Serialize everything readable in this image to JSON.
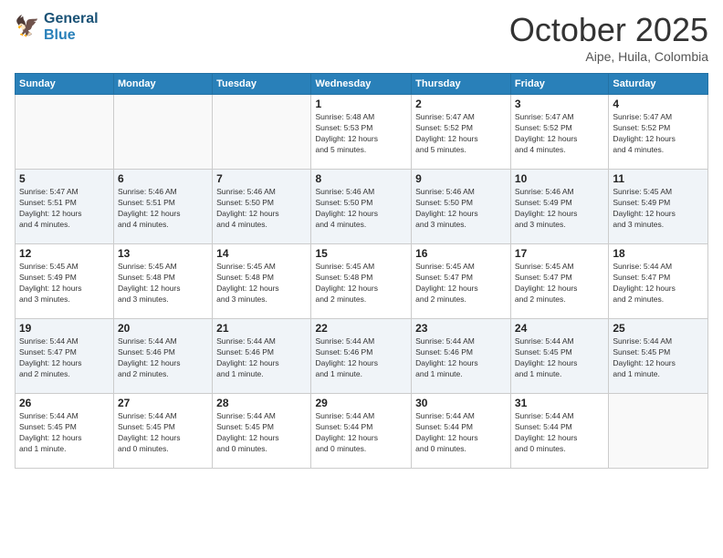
{
  "logo": {
    "line1": "General",
    "line2": "Blue"
  },
  "header": {
    "month": "October 2025",
    "location": "Aipe, Huila, Colombia"
  },
  "weekdays": [
    "Sunday",
    "Monday",
    "Tuesday",
    "Wednesday",
    "Thursday",
    "Friday",
    "Saturday"
  ],
  "weeks": [
    [
      {
        "day": "",
        "info": ""
      },
      {
        "day": "",
        "info": ""
      },
      {
        "day": "",
        "info": ""
      },
      {
        "day": "1",
        "info": "Sunrise: 5:48 AM\nSunset: 5:53 PM\nDaylight: 12 hours\nand 5 minutes."
      },
      {
        "day": "2",
        "info": "Sunrise: 5:47 AM\nSunset: 5:52 PM\nDaylight: 12 hours\nand 5 minutes."
      },
      {
        "day": "3",
        "info": "Sunrise: 5:47 AM\nSunset: 5:52 PM\nDaylight: 12 hours\nand 4 minutes."
      },
      {
        "day": "4",
        "info": "Sunrise: 5:47 AM\nSunset: 5:52 PM\nDaylight: 12 hours\nand 4 minutes."
      }
    ],
    [
      {
        "day": "5",
        "info": "Sunrise: 5:47 AM\nSunset: 5:51 PM\nDaylight: 12 hours\nand 4 minutes."
      },
      {
        "day": "6",
        "info": "Sunrise: 5:46 AM\nSunset: 5:51 PM\nDaylight: 12 hours\nand 4 minutes."
      },
      {
        "day": "7",
        "info": "Sunrise: 5:46 AM\nSunset: 5:50 PM\nDaylight: 12 hours\nand 4 minutes."
      },
      {
        "day": "8",
        "info": "Sunrise: 5:46 AM\nSunset: 5:50 PM\nDaylight: 12 hours\nand 4 minutes."
      },
      {
        "day": "9",
        "info": "Sunrise: 5:46 AM\nSunset: 5:50 PM\nDaylight: 12 hours\nand 3 minutes."
      },
      {
        "day": "10",
        "info": "Sunrise: 5:46 AM\nSunset: 5:49 PM\nDaylight: 12 hours\nand 3 minutes."
      },
      {
        "day": "11",
        "info": "Sunrise: 5:45 AM\nSunset: 5:49 PM\nDaylight: 12 hours\nand 3 minutes."
      }
    ],
    [
      {
        "day": "12",
        "info": "Sunrise: 5:45 AM\nSunset: 5:49 PM\nDaylight: 12 hours\nand 3 minutes."
      },
      {
        "day": "13",
        "info": "Sunrise: 5:45 AM\nSunset: 5:48 PM\nDaylight: 12 hours\nand 3 minutes."
      },
      {
        "day": "14",
        "info": "Sunrise: 5:45 AM\nSunset: 5:48 PM\nDaylight: 12 hours\nand 3 minutes."
      },
      {
        "day": "15",
        "info": "Sunrise: 5:45 AM\nSunset: 5:48 PM\nDaylight: 12 hours\nand 2 minutes."
      },
      {
        "day": "16",
        "info": "Sunrise: 5:45 AM\nSunset: 5:47 PM\nDaylight: 12 hours\nand 2 minutes."
      },
      {
        "day": "17",
        "info": "Sunrise: 5:45 AM\nSunset: 5:47 PM\nDaylight: 12 hours\nand 2 minutes."
      },
      {
        "day": "18",
        "info": "Sunrise: 5:44 AM\nSunset: 5:47 PM\nDaylight: 12 hours\nand 2 minutes."
      }
    ],
    [
      {
        "day": "19",
        "info": "Sunrise: 5:44 AM\nSunset: 5:47 PM\nDaylight: 12 hours\nand 2 minutes."
      },
      {
        "day": "20",
        "info": "Sunrise: 5:44 AM\nSunset: 5:46 PM\nDaylight: 12 hours\nand 2 minutes."
      },
      {
        "day": "21",
        "info": "Sunrise: 5:44 AM\nSunset: 5:46 PM\nDaylight: 12 hours\nand 1 minute."
      },
      {
        "day": "22",
        "info": "Sunrise: 5:44 AM\nSunset: 5:46 PM\nDaylight: 12 hours\nand 1 minute."
      },
      {
        "day": "23",
        "info": "Sunrise: 5:44 AM\nSunset: 5:46 PM\nDaylight: 12 hours\nand 1 minute."
      },
      {
        "day": "24",
        "info": "Sunrise: 5:44 AM\nSunset: 5:45 PM\nDaylight: 12 hours\nand 1 minute."
      },
      {
        "day": "25",
        "info": "Sunrise: 5:44 AM\nSunset: 5:45 PM\nDaylight: 12 hours\nand 1 minute."
      }
    ],
    [
      {
        "day": "26",
        "info": "Sunrise: 5:44 AM\nSunset: 5:45 PM\nDaylight: 12 hours\nand 1 minute."
      },
      {
        "day": "27",
        "info": "Sunrise: 5:44 AM\nSunset: 5:45 PM\nDaylight: 12 hours\nand 0 minutes."
      },
      {
        "day": "28",
        "info": "Sunrise: 5:44 AM\nSunset: 5:45 PM\nDaylight: 12 hours\nand 0 minutes."
      },
      {
        "day": "29",
        "info": "Sunrise: 5:44 AM\nSunset: 5:44 PM\nDaylight: 12 hours\nand 0 minutes."
      },
      {
        "day": "30",
        "info": "Sunrise: 5:44 AM\nSunset: 5:44 PM\nDaylight: 12 hours\nand 0 minutes."
      },
      {
        "day": "31",
        "info": "Sunrise: 5:44 AM\nSunset: 5:44 PM\nDaylight: 12 hours\nand 0 minutes."
      },
      {
        "day": "",
        "info": ""
      }
    ]
  ]
}
